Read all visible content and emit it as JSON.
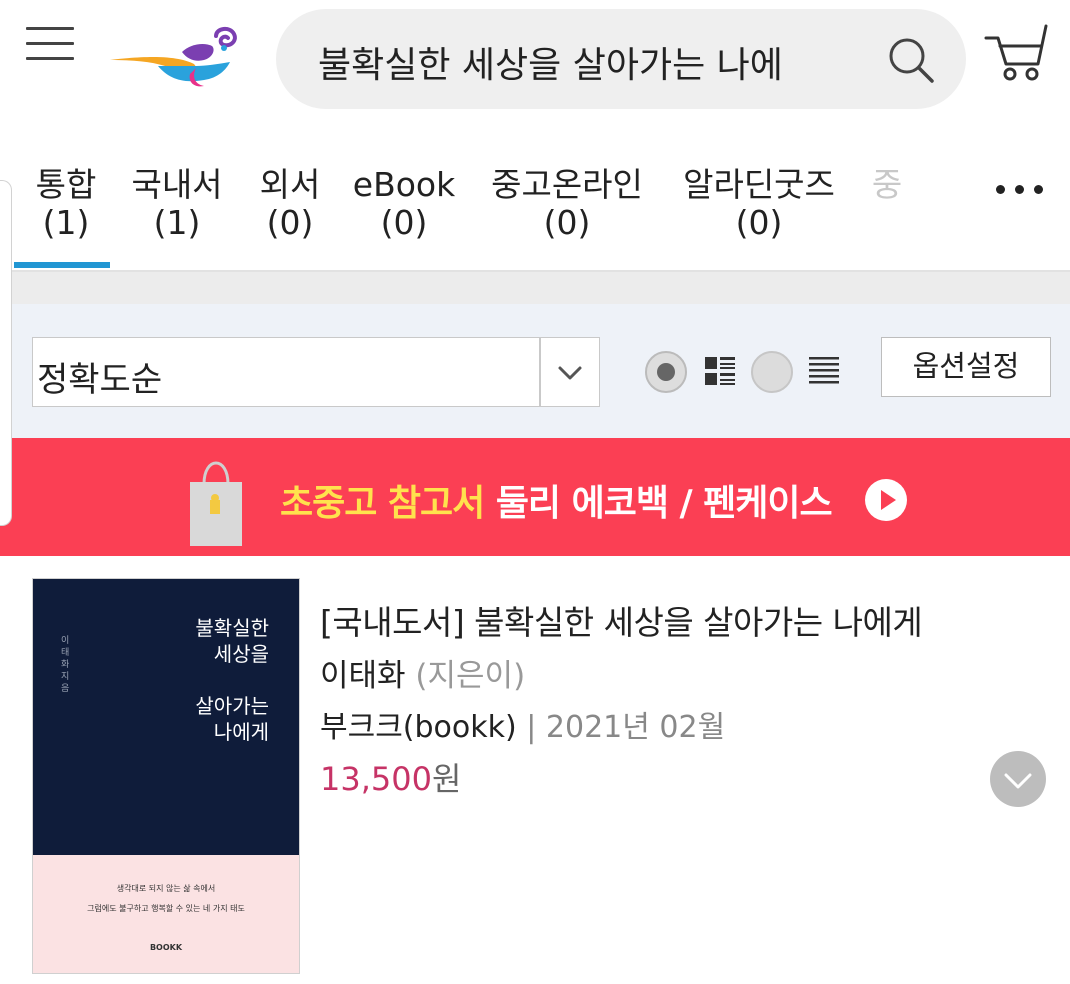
{
  "header": {
    "search_query": "불확실한 세상을 살아가는 나에",
    "icons": [
      "hamburger-menu-icon",
      "aladin-lamp-logo",
      "search-icon",
      "cart-icon"
    ]
  },
  "tabs": [
    {
      "label": "통합",
      "count": "(1)",
      "active": true
    },
    {
      "label": "국내서",
      "count": "(1)"
    },
    {
      "label": "외서",
      "count": "(0)"
    },
    {
      "label": "eBook",
      "count": "(0)"
    },
    {
      "label": "중고온라인",
      "count": "(0)"
    },
    {
      "label": "알라딘굿즈",
      "count": "(0)"
    },
    {
      "label": "중",
      "count": ""
    }
  ],
  "options": {
    "sort_selected": "정확도순",
    "view_modes": [
      "grid-view",
      "list-view"
    ],
    "selected_view": "grid-view",
    "option_button": "옵션설정"
  },
  "banner": {
    "text_yellow": "초중고 참고서",
    "text_white": "둘리 에코백 / 펜케이스"
  },
  "product": {
    "title": "[국내도서] 불확실한 세상을 살아가는 나에게",
    "author": "이태화",
    "author_role": "(지은이)",
    "publisher": "부크크(bookk)",
    "separator": "|",
    "date": "2021년 02월",
    "price": "13,500",
    "currency": "원",
    "cover": {
      "title": "불확실한\n세상을\n\n살아가는\n나에게",
      "author": "이태화 지음",
      "tagline": "생각대로 되지 않는 삶 속에서\n그럼에도 불구하고 행복할 수 있는 네 가지 태도",
      "publisher": "BOOKK"
    }
  },
  "colors": {
    "accent_blue": "#2196d3",
    "banner_red": "#fb3f54",
    "banner_yellow": "#ffe24d",
    "price_pink": "#c63366",
    "cover_navy": "#0f1c3a",
    "cover_pink": "#fbe2e3"
  }
}
